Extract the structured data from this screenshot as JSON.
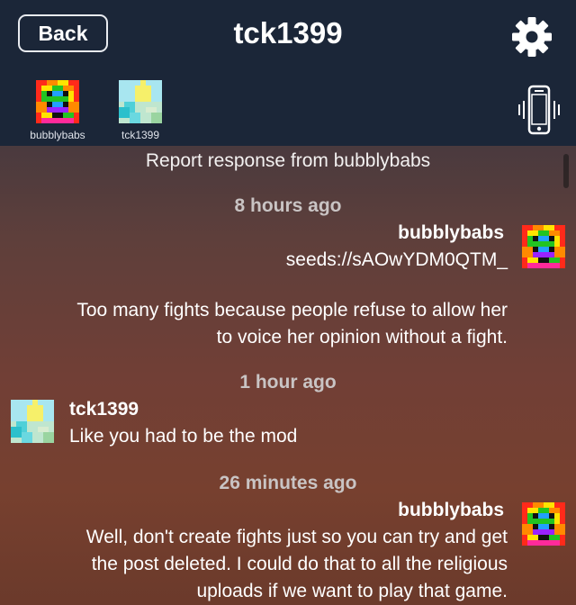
{
  "header": {
    "back_label": "Back",
    "title": "tck1399",
    "settings_icon": "gear-icon"
  },
  "participants": [
    {
      "name": "bubblybabs",
      "avatar": "pixel-avatar-rainbow"
    },
    {
      "name": "tck1399",
      "avatar": "pixel-avatar-sky"
    }
  ],
  "call_icon": "phone-vibrate-icon",
  "notice": "Report response from bubblybabs",
  "messages": [
    {
      "timestamp": "8 hours ago",
      "sender": "bubblybabs",
      "side": "right",
      "lines": [
        "seeds://sAOwYDM0QTM_"
      ]
    },
    {
      "timestamp": "",
      "sender": "",
      "side": "right",
      "lines": [
        "Too many fights because people refuse to allow her",
        "to voice her opinion without a fight."
      ]
    },
    {
      "timestamp": "1 hour ago",
      "sender": "tck1399",
      "side": "left",
      "lines": [
        "Like you had to be the mod"
      ]
    },
    {
      "timestamp": "26 minutes ago",
      "sender": "bubblybabs",
      "side": "right",
      "lines": [
        "Well, don't create fights just so you can try and get",
        "the post deleted.  I could do that to all the religious",
        "uploads if we want to play that game."
      ]
    }
  ],
  "colors": {
    "header_bg": "#1b2638",
    "text": "#ffffff",
    "timestamp": "#c9c4c4"
  }
}
